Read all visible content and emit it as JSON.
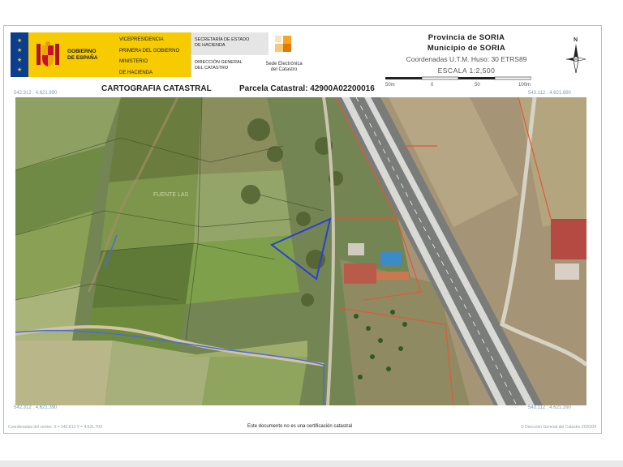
{
  "header": {
    "gobierno_line1": "GOBIERNO",
    "gobierno_line2": "DE ESPAÑA",
    "vice_line1": "VICEPRESIDENCIA",
    "vice_line2": "PRIMERA DEL GOBIERNO",
    "ministerio_line1": "MINISTERIO",
    "ministerio_line2": "DE HACIENDA",
    "secretaria_line1": "SECRETARÍA DE ESTADO",
    "secretaria_line2": "DE HACIENDA",
    "direccion_line1": "DIRECCIÓN GENERAL",
    "direccion_line2": "DEL CATASTRO",
    "sede_line1": "Sede Electrónica",
    "sede_line2": "del Catastro",
    "provincia": "Provincia de SORIA",
    "municipio": "Municipio de SORIA",
    "coordenadas": "Coordenadas U.T.M. Huso: 30 ETRS89",
    "escala": "ESCALA 1:2,500",
    "scale_ticks": [
      "50m",
      "0",
      "50",
      "100m"
    ],
    "north_label": "N"
  },
  "titles": {
    "cartografia": "CARTOGRAFIA CATASTRAL",
    "parcela": "Parcela Catastral: 42900A02200016"
  },
  "corners": {
    "top_left": "542.312 : 4.621.890",
    "top_right": "543.112 : 4.621.890",
    "bottom_left": "542.312 : 4.621.390",
    "bottom_right": "543.112 : 4.621.390"
  },
  "map": {
    "place_label": "FUENTE LAS",
    "parcel_outline_color": "#2b3fd6",
    "boundary_color": "#e0583a"
  },
  "footer": {
    "left": "Coordenadas del centro: X = 542.812 Y = 4.621.709",
    "center": "Este documento no es una certificación catastral",
    "right": "© Dirección General del Catastro 2020/04"
  },
  "colors": {
    "spain_yellow": "#f6cb00",
    "spain_blue": "#0b3e8f",
    "corner_text": "#7e9bb5"
  }
}
